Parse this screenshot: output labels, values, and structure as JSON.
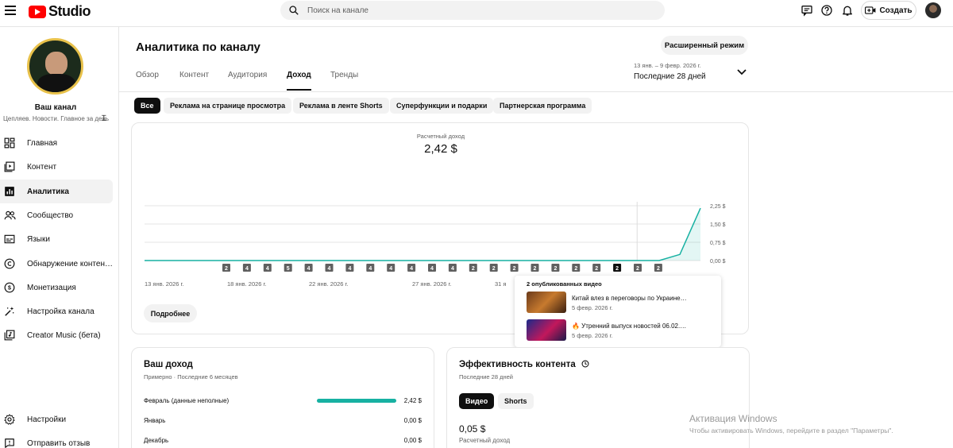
{
  "app": {
    "logo_text": "Studio"
  },
  "search": {
    "placeholder": "Поиск на канале"
  },
  "header": {
    "create_label": "Создать"
  },
  "channel": {
    "name": "Ваш канал",
    "description": "Цепляев. Новости. Главное за день"
  },
  "sidebar": {
    "items": [
      {
        "label": "Главная",
        "icon": "dashboard-icon"
      },
      {
        "label": "Контент",
        "icon": "content-icon"
      },
      {
        "label": "Аналитика",
        "icon": "analytics-icon",
        "active": true
      },
      {
        "label": "Сообщество",
        "icon": "community-icon"
      },
      {
        "label": "Языки",
        "icon": "subtitles-icon"
      },
      {
        "label": "Обнаружение контен…",
        "icon": "copyright-icon"
      },
      {
        "label": "Монетизация",
        "icon": "dollar-icon"
      },
      {
        "label": "Настройка канала",
        "icon": "magic-wand-icon"
      },
      {
        "label": "Creator Music (бета)",
        "icon": "music-library-icon"
      }
    ],
    "bottom": [
      {
        "label": "Настройки",
        "icon": "gear-icon"
      },
      {
        "label": "Отправить отзыв",
        "icon": "feedback-icon"
      }
    ]
  },
  "page": {
    "title": "Аналитика по каналу",
    "advanced_button": "Расширенный режим",
    "tabs": [
      "Обзор",
      "Контент",
      "Аудитория",
      "Доход",
      "Тренды"
    ],
    "active_tab": "Доход",
    "date_range_small": "13 янв. – 9 февр. 2026 г.",
    "date_range_label": "Последние 28 дней"
  },
  "chips": {
    "items": [
      "Все",
      "Реклама на странице просмотра",
      "Реклама в ленте Shorts",
      "Суперфункции и подарки",
      "Партнерская программа"
    ],
    "active": "Все"
  },
  "chart_card": {
    "metric_label": "Расчетный доход",
    "metric_value": "2,42 $",
    "more_button": "Подробнее"
  },
  "chart_data": {
    "type": "area",
    "series_color": "#17b1a2",
    "x_tick_labels": [
      "13 янв. 2026 г.",
      "18 янв. 2026 г.",
      "22 янв. 2026 г.",
      "27 янв. 2026 г.",
      "31 я"
    ],
    "y_tick_labels": [
      "0,00 $",
      "0,75 $",
      "1,50 $",
      "2,25 $"
    ],
    "ylim": [
      0,
      2.25
    ],
    "values": [
      0,
      0,
      0,
      0,
      0,
      0,
      0,
      0,
      0,
      0,
      0,
      0,
      0,
      0,
      0,
      0,
      0,
      0,
      0,
      0,
      0,
      0,
      0,
      0,
      0,
      0,
      0.25,
      2.15
    ],
    "upload_markers": [
      "2",
      "4",
      "4",
      "5",
      "4",
      "4",
      "4",
      "4",
      "4",
      "4",
      "4",
      "4",
      "2",
      "2",
      "2",
      "2",
      "2",
      "2",
      "2",
      "2",
      "2",
      "2"
    ],
    "highlighted_marker_index": 19,
    "grid": true
  },
  "tooltip": {
    "title": "2 опубликованных видео",
    "videos": [
      {
        "title": "Китай влез в переговоры по Украине…",
        "date": "5 февр. 2026 г."
      },
      {
        "title": "🔥 Утренний выпуск новостей 06.02.…",
        "date": "5 февр. 2026 г."
      }
    ]
  },
  "revenue_card": {
    "title": "Ваш доход",
    "subtitle": "Примерно · Последние 6 месяцев",
    "rows": [
      {
        "label": "Февраль (данные неполные)",
        "value": "2,42 $",
        "fraction": 1.0
      },
      {
        "label": "Январь",
        "value": "0,00 $",
        "fraction": 0
      },
      {
        "label": "Декабрь",
        "value": "0,00 $",
        "fraction": 0
      }
    ]
  },
  "efficiency_card": {
    "title": "Эффективность контента",
    "subtitle": "Последние 28 дней",
    "chips": [
      "Видео",
      "Shorts"
    ],
    "active_chip": "Видео",
    "value": "0,05 $",
    "value_label": "Расчетный доход"
  },
  "watermark": {
    "title": "Активация Windows",
    "subtitle": "Чтобы активировать Windows, перейдите в раздел \"Параметры\"."
  }
}
